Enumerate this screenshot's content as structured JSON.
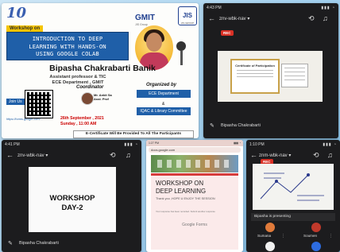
{
  "poster": {
    "anniversary": "10",
    "workshop_tag": "Workshop on",
    "org_logo_text": "GMIT",
    "org_logo_sub": "JIS Group",
    "jis_logo": "JIS",
    "jis_logo_sub": "JIS GROUP",
    "title_line1": "INTRODUCTION TO DEEP",
    "title_line2": "LEARNING WITH HANDS-ON",
    "title_line3": "USING GOOGLE COLAB",
    "speaker_name": "Bipasha Chakrabarti Banik",
    "speaker_role": "Assistant professor & TIC",
    "speaker_dept": "ECE Department , GMIT",
    "join_text": "Join Us",
    "url": "https://forms.google.com/...",
    "coordinator_label": "Coordinator",
    "coordinator_name": "Mr. Ankit Sa",
    "coordinator_role": "Asst. Prof",
    "organized_label": "Organized by",
    "org_box_1": "ECE Department",
    "org_amp": "&",
    "org_box_2": "IQAC & Library Committee",
    "date_line1": "26th September , 2021",
    "date_line2": "Sunday , 11:00 AM",
    "certificate_note": "E-Certificate Will Be Provided To All The Participants"
  },
  "meet1": {
    "status_left": "4:43 PM",
    "status_right": "▮▮▮ ◔",
    "meeting_code": "znv-wbk-nav ▾",
    "rec_label": "REC",
    "cert_heading": "Certificate of Participation",
    "presenter": "Bipasha Chakrabarti"
  },
  "meet2": {
    "status_left": "4:41 PM",
    "status_right": "▮▮▮ ◔",
    "meeting_code": "znv-wbk-nav ▾",
    "slide_line1": "WORKSHOP",
    "slide_line2": "DAY-2",
    "presenter": "Bipasha Chakrabarti"
  },
  "browser": {
    "status_left": "1:27 PM",
    "status_right": "▮▮▮ ◔",
    "url": "docs.google.com",
    "ws_line1": "WORKSHOP ON",
    "ws_line2": "DEEP LEARNING",
    "thanks": "Thank you ,HOPE U ENJOY THE SESSION",
    "response_note": "Your response has been recorded. Submit another response",
    "footer": "Google Forms"
  },
  "meet3": {
    "status_left": "1:10 PM",
    "status_right": "▮▮▮ ◔",
    "meeting_code": "znm-wbk-nav ▾",
    "rec_label": "REC",
    "presenting_label": "Bipasha is presenting",
    "participant_1": "Sumana",
    "participant_2": "Soumen"
  },
  "colors": {
    "accent": "#1f5fa8",
    "rec": "#d93025",
    "banner": "#1f5fa8",
    "date_red": "#cc0000"
  }
}
